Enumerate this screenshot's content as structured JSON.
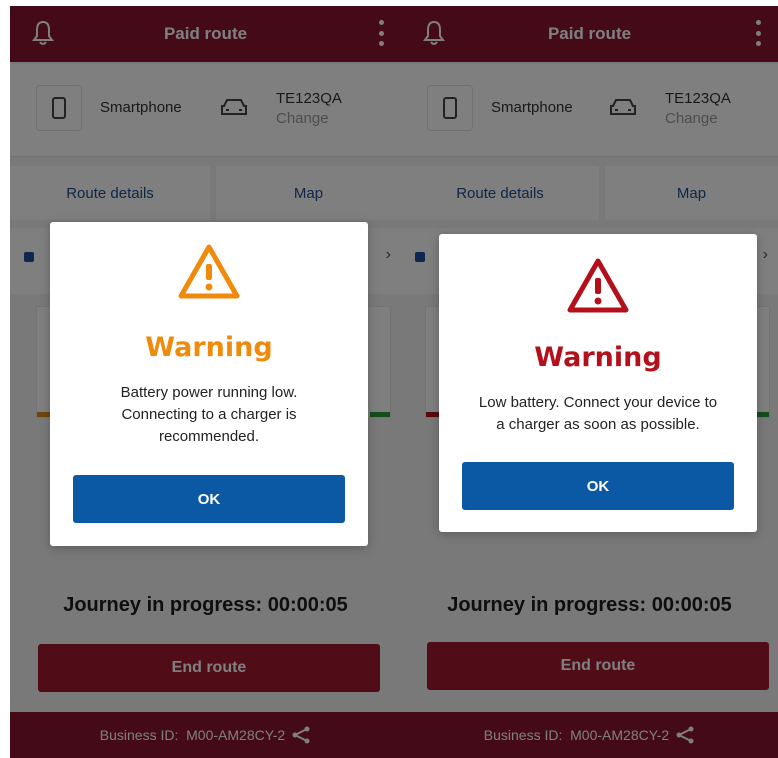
{
  "colors": {
    "header_bg": "#8b1530",
    "end_button_bg": "#a01a2e",
    "tab_text": "#1f4d8f",
    "ok_button_bg": "#0b58a5",
    "warning_orange": "#f08a0b",
    "warning_red": "#b3101c"
  },
  "screens": [
    {
      "header": {
        "title": "Paid route",
        "left_icon": "bell-icon",
        "right_icon": "more-vertical-icon"
      },
      "devices": {
        "phone_label": "Smartphone",
        "phone_icon": "smartphone-icon",
        "car_icon": "car-icon",
        "plate": "TE123QA",
        "change_label": "Change"
      },
      "tabs": [
        "Route details",
        "Map"
      ],
      "journey": "Journey in progress: 00:00:05",
      "end_button": "End route",
      "footer": {
        "business_id_label": "Business ID:",
        "business_id": "M00-AM28CY-2",
        "share_icon": "share-icon"
      },
      "dialog": {
        "icon": "warning-triangle-icon",
        "title": "Warning",
        "title_color": "#f08a0b",
        "message_lines": [
          "Battery power running low.",
          "Connecting to a charger is",
          "recommended."
        ],
        "ok_label": "OK"
      }
    },
    {
      "header": {
        "title": "Paid route",
        "left_icon": "bell-icon",
        "right_icon": "more-vertical-icon"
      },
      "devices": {
        "phone_label": "Smartphone",
        "phone_icon": "smartphone-icon",
        "car_icon": "car-icon",
        "plate": "TE123QA",
        "change_label": "Change"
      },
      "tabs": [
        "Route details",
        "Map"
      ],
      "journey": "Journey in progress: 00:00:05",
      "end_button": "End route",
      "footer": {
        "business_id_label": "Business ID:",
        "business_id": "M00-AM28CY-2",
        "share_icon": "share-icon"
      },
      "dialog": {
        "icon": "warning-triangle-icon",
        "title": "Warning",
        "title_color": "#b3101c",
        "message_lines": [
          "Low battery. Connect your device to",
          "a charger as soon as possible."
        ],
        "ok_label": "OK"
      }
    }
  ]
}
